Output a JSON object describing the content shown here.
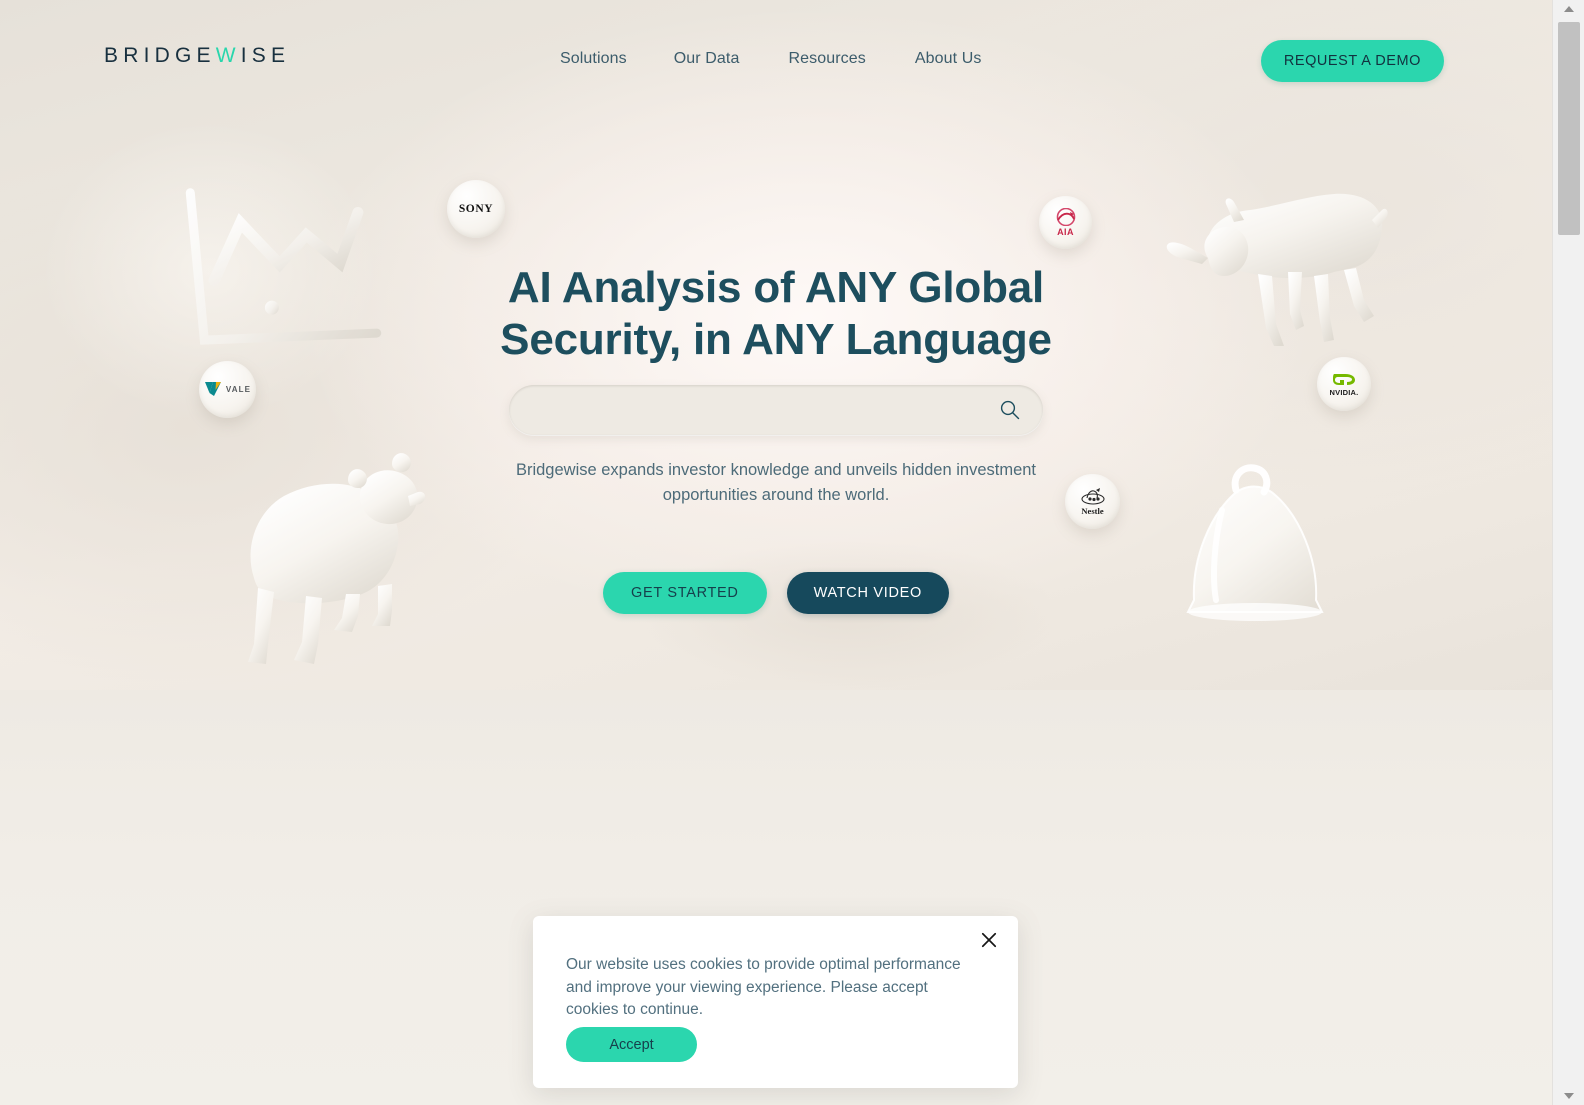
{
  "header": {
    "logo_text": "BRIDGEWISE",
    "nav": [
      {
        "label": "Solutions"
      },
      {
        "label": "Our Data"
      },
      {
        "label": "Resources"
      },
      {
        "label": "About Us"
      }
    ],
    "demo_button": "REQUEST A DEMO"
  },
  "hero": {
    "headline": "AI Analysis of ANY Global Security, in ANY Language",
    "search_value": "",
    "search_placeholder": "",
    "search_icon": "search-icon",
    "subtitle": "Bridgewise expands investor knowledge and unveils hidden investment opportunities around the world.",
    "primary_cta": "GET STARTED",
    "secondary_cta": "WATCH VIDEO"
  },
  "decorations": [
    {
      "name": "bar-chart-3d",
      "label": "3D bar chart with trend line"
    },
    {
      "name": "bull-3d",
      "label": "3D glossy bull"
    },
    {
      "name": "bear-3d",
      "label": "3D glossy bear"
    },
    {
      "name": "bell-3d",
      "label": "3D glass bell"
    }
  ],
  "logo_badges": [
    {
      "name": "sony",
      "text": "SONY"
    },
    {
      "name": "vale",
      "text": "VALE"
    },
    {
      "name": "aia",
      "text": "AIA"
    },
    {
      "name": "nvidia",
      "text": "NVIDIA."
    },
    {
      "name": "nestle",
      "text": "Nestle"
    }
  ],
  "cookie_banner": {
    "message": "Our website uses cookies to provide optimal performance and improve your viewing experience. Please accept cookies to continue.",
    "accept_label": "Accept",
    "close_icon": "close-icon"
  },
  "colors": {
    "accent_teal": "#2bd6ae",
    "dark_navy": "#16495c",
    "headline": "#1d4e5e",
    "body_text": "#4d6b79",
    "page_bg": "#efece6"
  },
  "browser": {
    "scroll_up_icon": "scroll-up-arrow-icon",
    "scroll_down_icon": "scroll-down-arrow-icon"
  }
}
